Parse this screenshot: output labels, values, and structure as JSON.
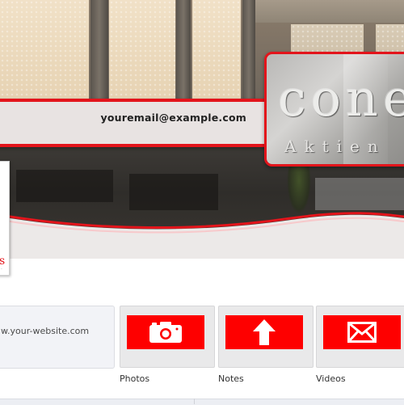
{
  "header": {
    "email": "youremail@example.com"
  },
  "logo": {
    "word": "cone",
    "subtitle": "Aktien"
  },
  "profile": {
    "mark": "s",
    "mark_sub": "·"
  },
  "info": {
    "website": "w.your-website.com"
  },
  "apps": [
    {
      "label": "Photos",
      "icon": "camera-icon"
    },
    {
      "label": "Notes",
      "icon": "upload-arrow-icon"
    },
    {
      "label": "Videos",
      "icon": "envelope-icon"
    }
  ],
  "colors": {
    "accent_red": "#e3141b",
    "tile_red": "#fe0000"
  }
}
